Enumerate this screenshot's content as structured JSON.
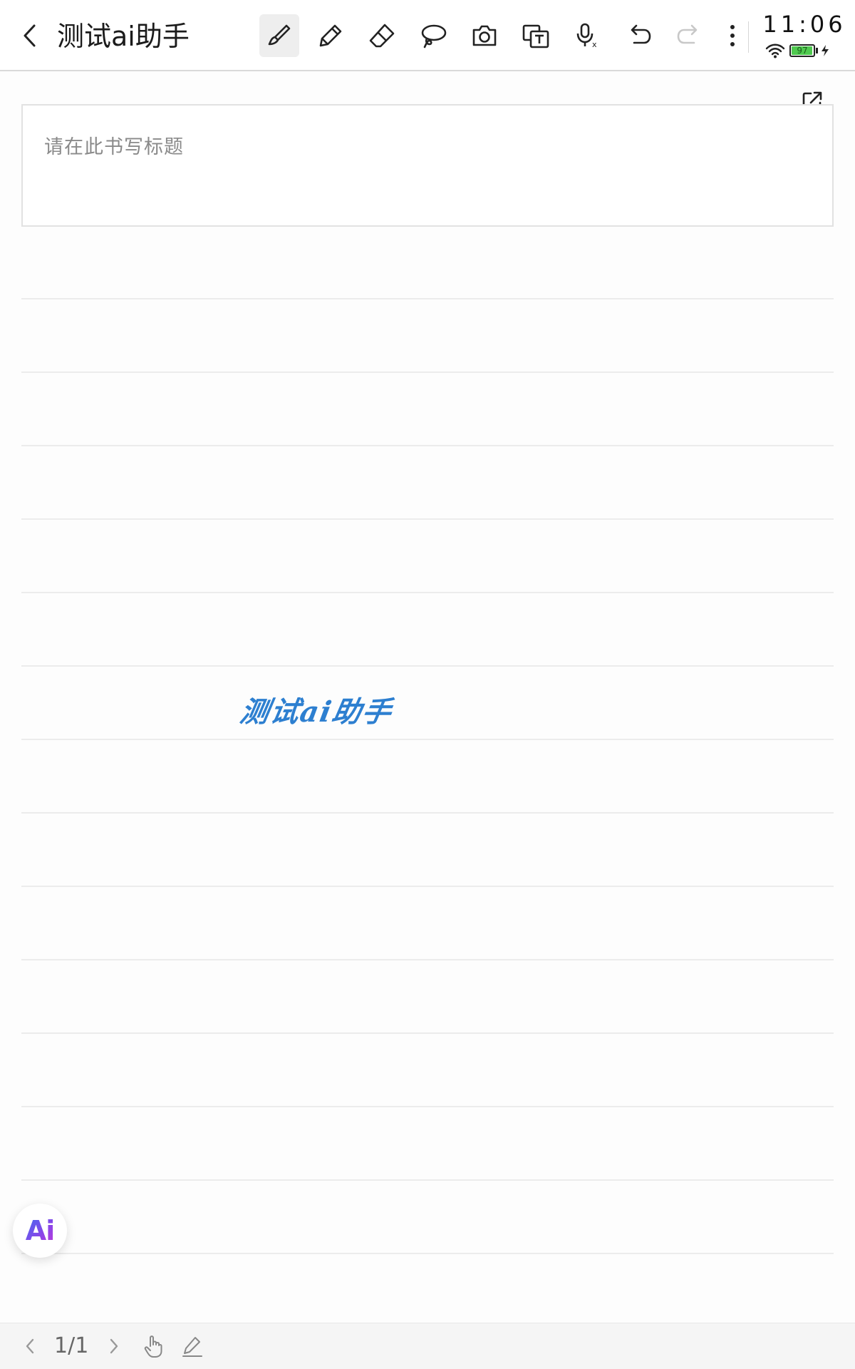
{
  "topbar": {
    "back_icon": "chevron-left-icon",
    "title": "测试ai助手",
    "tools": [
      {
        "name": "brush-tool",
        "icon": "brush-icon",
        "active": true
      },
      {
        "name": "pencil-tool",
        "icon": "pencil-icon",
        "active": false
      },
      {
        "name": "eraser-tool",
        "icon": "eraser-icon",
        "active": false
      },
      {
        "name": "lasso-tool",
        "icon": "lasso-icon",
        "active": false
      },
      {
        "name": "camera-tool",
        "icon": "camera-icon",
        "active": false
      },
      {
        "name": "text-recognition-tool",
        "icon": "text-box-icon",
        "active": false
      },
      {
        "name": "voice-input-tool",
        "icon": "microphone-icon",
        "active": false
      },
      {
        "name": "undo-button",
        "icon": "undo-icon",
        "enabled": true
      },
      {
        "name": "redo-button",
        "icon": "redo-icon",
        "enabled": false
      },
      {
        "name": "more-menu",
        "icon": "more-vertical-icon",
        "enabled": true
      }
    ]
  },
  "status_bar": {
    "time": "11:06",
    "wifi_icon": "wifi-icon",
    "battery_level": "97",
    "battery_fraction": 0.97,
    "charging": true
  },
  "page": {
    "title_placeholder": "请在此书写标题",
    "handwritten_text": "测试ai助手",
    "handwriting_color": "#2d7fd0",
    "export_icon": "export-icon"
  },
  "ai_button": {
    "label": "Ai"
  },
  "bottom_bar": {
    "page_indicator": "1/1",
    "prev_icon": "chevron-left-icon",
    "next_icon": "chevron-right-icon",
    "hand_icon": "hand-pointer-icon",
    "pen_icon": "pen-icon"
  },
  "colors": {
    "accent_blue": "#2d7fd0",
    "battery_green": "#4fc94f",
    "ruled_line": "#ececec"
  }
}
